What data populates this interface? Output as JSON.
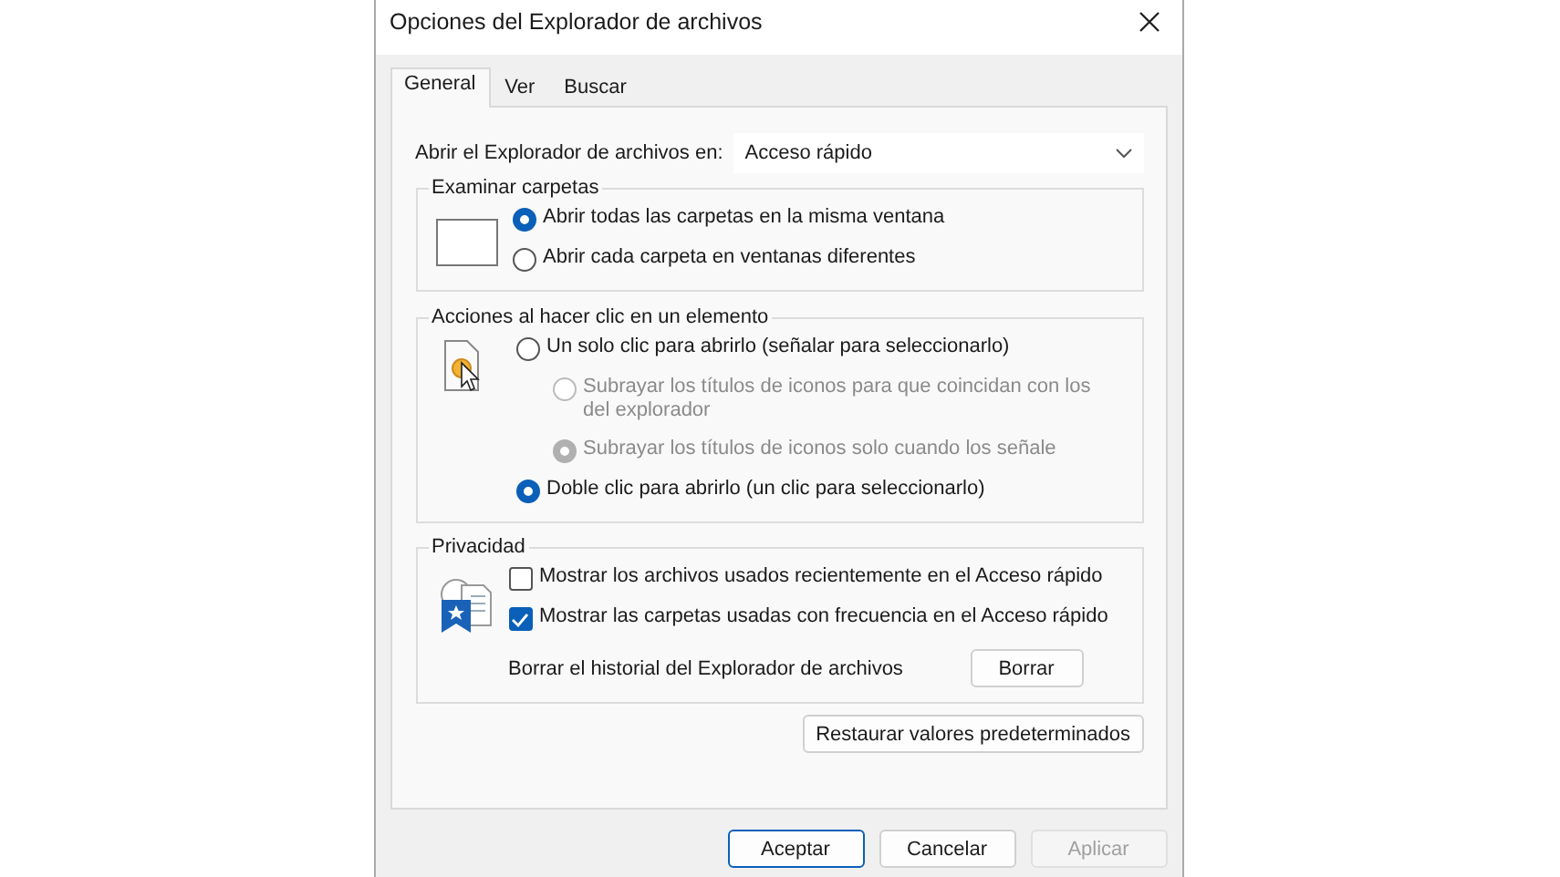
{
  "window": {
    "title": "Opciones del Explorador de archivos"
  },
  "tabs": [
    {
      "label": "General",
      "selected": true
    },
    {
      "label": "Ver",
      "selected": false
    },
    {
      "label": "Buscar",
      "selected": false
    }
  ],
  "open_in": {
    "label": "Abrir el Explorador de archivos en:",
    "value": "Acceso rápido"
  },
  "browse_folders": {
    "title": "Examinar carpetas",
    "options": [
      {
        "label": "Abrir todas las carpetas en la misma ventana",
        "selected": true,
        "disabled": false
      },
      {
        "label": "Abrir cada carpeta en ventanas diferentes",
        "selected": false,
        "disabled": false
      }
    ]
  },
  "click_items": {
    "title": "Acciones al hacer clic en un elemento",
    "options": [
      {
        "label": "Un solo clic para abrirlo (señalar para seleccionarlo)",
        "selected": false,
        "disabled": false,
        "children": [
          {
            "label": "Subrayar los títulos de iconos para que coincidan con los del explorador",
            "selected": false,
            "disabled": true
          },
          {
            "label": "Subrayar los títulos de iconos solo cuando los señale",
            "selected": true,
            "disabled": true
          }
        ]
      },
      {
        "label": "Doble clic para abrirlo (un clic para seleccionarlo)",
        "selected": true,
        "disabled": false
      }
    ]
  },
  "privacy": {
    "title": "Privacidad",
    "checkboxes": [
      {
        "label": "Mostrar los archivos usados recientemente en el Acceso rápido",
        "checked": false
      },
      {
        "label": "Mostrar las carpetas usadas con frecuencia en el Acceso rápido",
        "checked": true
      }
    ],
    "clear_label": "Borrar el historial del Explorador de archivos",
    "clear_button": "Borrar"
  },
  "restore_button": "Restaurar valores predeterminados",
  "buttons": [
    {
      "label": "Aceptar",
      "default": true,
      "disabled": false
    },
    {
      "label": "Cancelar",
      "default": false,
      "disabled": false
    },
    {
      "label": "Aplicar",
      "default": false,
      "disabled": true
    }
  ]
}
